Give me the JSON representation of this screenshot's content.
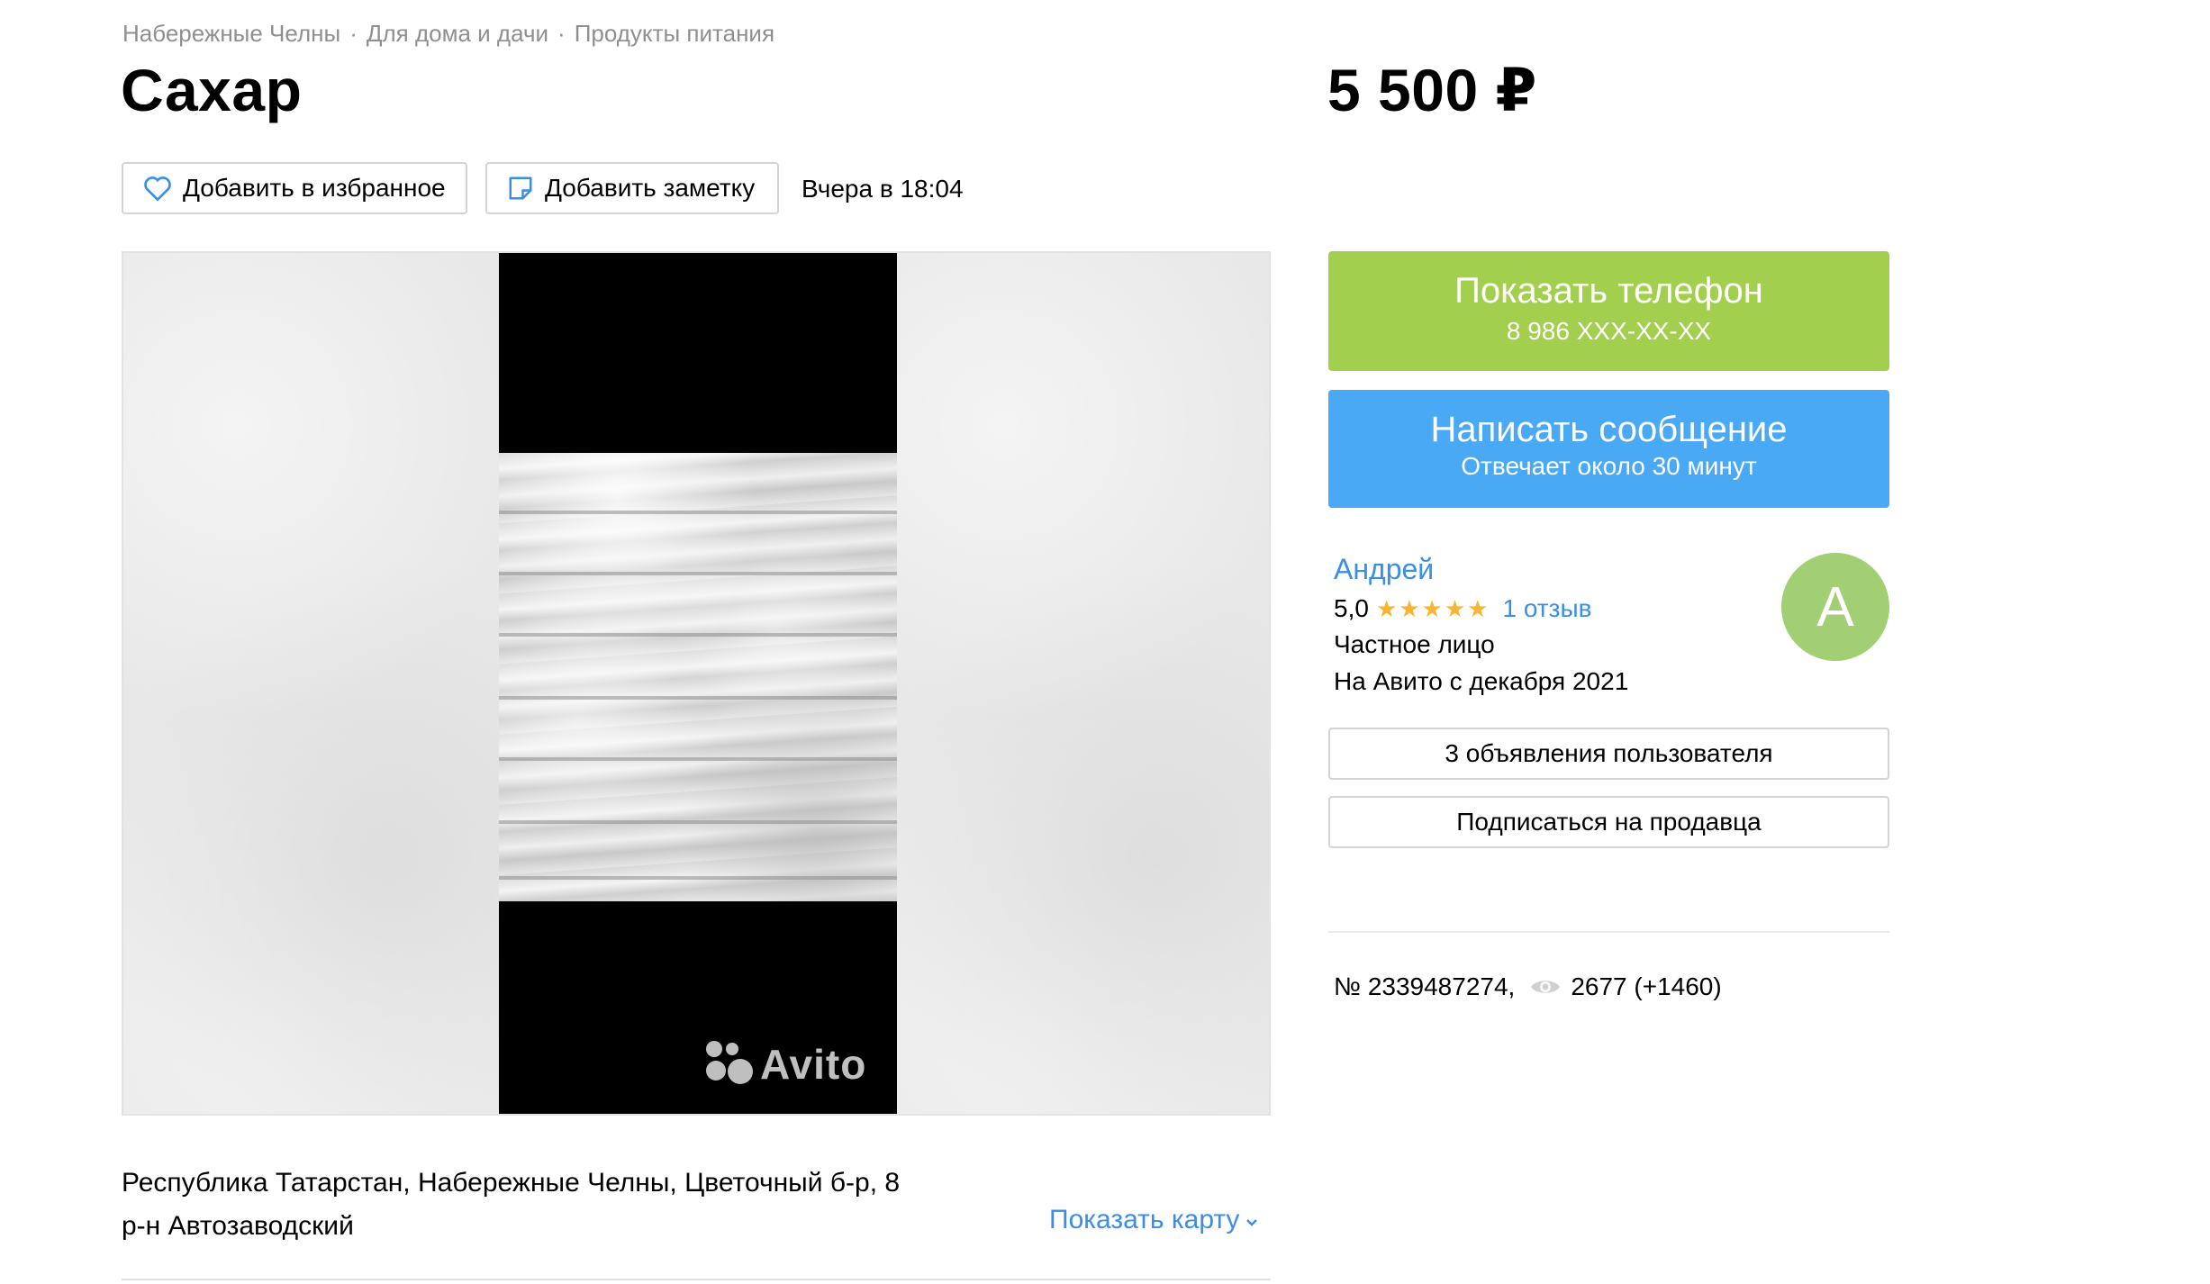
{
  "breadcrumb": {
    "items": [
      "Набережные Челны",
      "Для дома и дачи",
      "Продукты питания"
    ],
    "separator": "·"
  },
  "listing": {
    "title": "Сахар",
    "price": "5 500 ₽",
    "posted": "Вчера в 18:04",
    "number": "№ 2339487274,",
    "views": "2677 (+1460)"
  },
  "actions": {
    "favorite_label": "Добавить в избранное",
    "note_label": "Добавить заметку"
  },
  "gallery": {
    "watermark": "Avito"
  },
  "contact": {
    "phone_label": "Показать телефон",
    "phone_masked": "8 986 XXX-XX-XX",
    "message_label": "Написать сообщение",
    "message_sub": "Отвечает около 30 минут"
  },
  "seller": {
    "name": "Андрей",
    "rating": "5,0",
    "stars": "★★★★★",
    "reviews": "1 отзыв",
    "type": "Частное лицо",
    "since": "На Авито с декабря 2021",
    "avatar_letter": "А",
    "user_ads_label": "3 объявления пользователя",
    "subscribe_label": "Подписаться на продавца"
  },
  "location": {
    "address": "Республика Татарстан, Набережные Челны, Цветочный б-р, 8",
    "district": "р-н Автозаводский",
    "show_map_label": "Показать карту"
  },
  "colors": {
    "phone_button": "#a3cf4e",
    "message_button": "#4aa9f5",
    "link": "#3a8ee6",
    "stars": "#f7b531",
    "avatar": "#a3cf74"
  },
  "icons": [
    "heart-icon",
    "note-icon",
    "eye-icon",
    "chevron-down-icon"
  ]
}
